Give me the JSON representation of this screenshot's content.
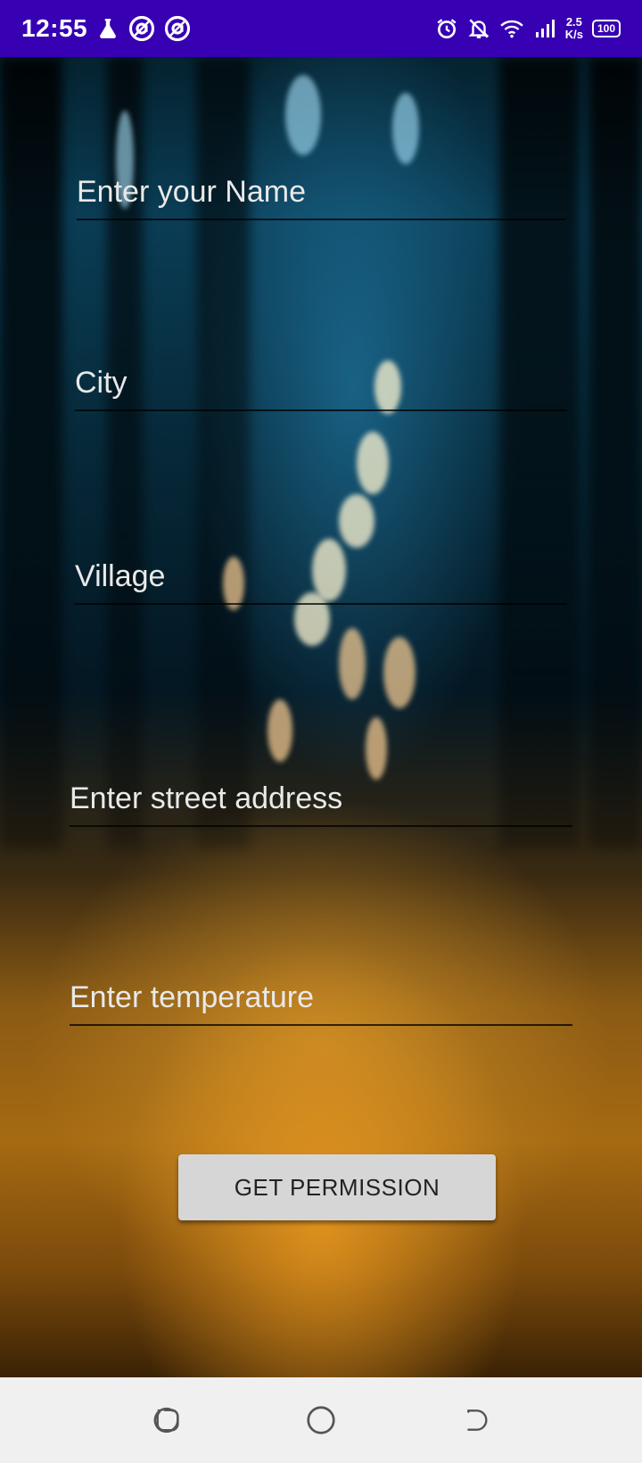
{
  "status_bar": {
    "time": "12:55",
    "net_speed_value": "2.5",
    "net_speed_unit": "K/s",
    "battery": "100",
    "left_icons": [
      "lab-flask-icon",
      "circle-a-icon",
      "circle-a-icon"
    ],
    "right_icons": [
      "alarm-icon",
      "bell-off-icon",
      "wifi-icon",
      "signal-icon",
      "battery-icon"
    ],
    "color": "#3700b3"
  },
  "form": {
    "name_placeholder": "Enter your Name",
    "city_placeholder": "City",
    "village_placeholder": "Village",
    "street_placeholder": "Enter street address",
    "temperature_placeholder": "Enter temperature",
    "button_label": "GET PERMISSION"
  },
  "nav_bar": {
    "icons": [
      "recent-apps-icon",
      "home-icon",
      "back-icon"
    ]
  }
}
